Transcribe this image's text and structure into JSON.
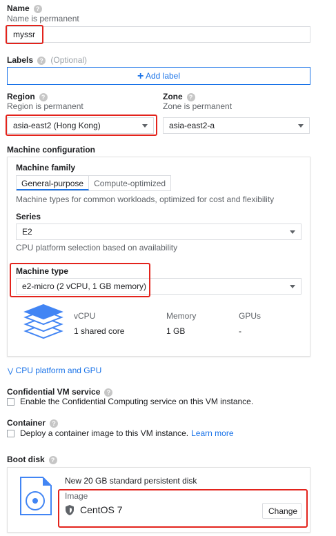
{
  "name": {
    "label": "Name",
    "hint": "Name is permanent",
    "value": "myssr"
  },
  "labels": {
    "label": "Labels",
    "optional": "(Optional)",
    "add_button": "Add label"
  },
  "region": {
    "label": "Region",
    "hint": "Region is permanent",
    "value": "asia-east2 (Hong Kong)"
  },
  "zone": {
    "label": "Zone",
    "hint": "Zone is permanent",
    "value": "asia-east2-a"
  },
  "machine_configuration": {
    "label": "Machine configuration",
    "family_label": "Machine family",
    "tabs": [
      "General-purpose",
      "Compute-optimized"
    ],
    "family_description": "Machine types for common workloads, optimized for cost and flexibility",
    "series_label": "Series",
    "series_value": "E2",
    "series_hint": "CPU platform selection based on availability",
    "machine_type_label": "Machine type",
    "machine_type_value": "e2-micro (2 vCPU, 1 GB memory)",
    "specs": {
      "headers": [
        "vCPU",
        "Memory",
        "GPUs"
      ],
      "values": [
        "1 shared core",
        "1 GB",
        "-"
      ]
    }
  },
  "cpu_platform_link": "CPU platform and GPU",
  "confidential": {
    "label": "Confidential VM service",
    "checkbox_text": "Enable the Confidential Computing service on this VM instance."
  },
  "container": {
    "label": "Container",
    "checkbox_text": "Deploy a container image to this VM instance.",
    "learn_more": "Learn more"
  },
  "boot_disk": {
    "label": "Boot disk",
    "description": "New 20 GB standard persistent disk",
    "image_label": "Image",
    "image_value": "CentOS 7",
    "change_button": "Change"
  },
  "colors": {
    "accent": "#1a73e8",
    "highlight_red": "#e3231c",
    "icon_blue": "#4285f4"
  }
}
